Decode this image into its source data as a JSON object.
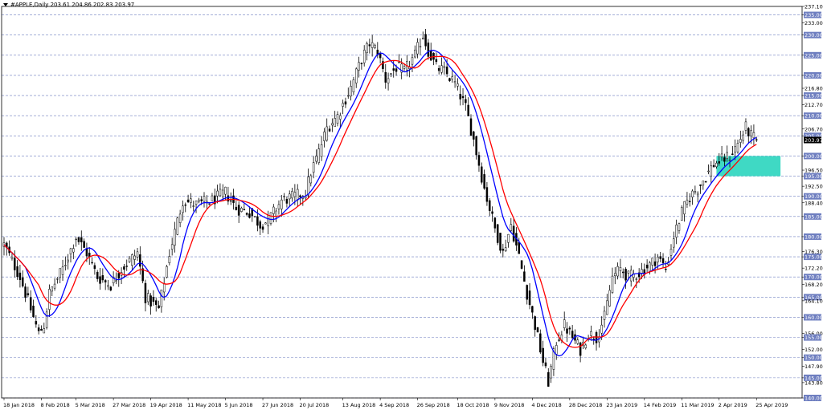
{
  "header": {
    "title": "#APPLE,Daily  203.61 204.86 202.83 203.97"
  },
  "chart_data": {
    "type": "candlestick",
    "title": "#APPLE,Daily  203.61 204.86 202.83 203.97",
    "ylim": [
      140.0,
      237.1
    ],
    "grid": true,
    "y_ticks": [
      {
        "value": 237.1,
        "label": "237.10",
        "badge": false
      },
      {
        "value": 235.0,
        "label": "235.00",
        "badge": true
      },
      {
        "value": 233.0,
        "label": "233.00",
        "badge": false
      },
      {
        "value": 230.0,
        "label": "230.00",
        "badge": true
      },
      {
        "value": 225.0,
        "label": "225.00",
        "badge": true
      },
      {
        "value": 220.0,
        "label": "220.00",
        "badge": true
      },
      {
        "value": 216.8,
        "label": "216.80",
        "badge": false
      },
      {
        "value": 215.0,
        "label": "215.00",
        "badge": true
      },
      {
        "value": 212.7,
        "label": "212.70",
        "badge": false
      },
      {
        "value": 210.0,
        "label": "210.00",
        "badge": true
      },
      {
        "value": 206.7,
        "label": "206.70",
        "badge": false
      },
      {
        "value": 205.0,
        "label": "205.00",
        "badge": true
      },
      {
        "value": 200.0,
        "label": "200.00",
        "badge": true
      },
      {
        "value": 196.5,
        "label": "196.50",
        "badge": false
      },
      {
        "value": 195.0,
        "label": "195.00",
        "badge": true
      },
      {
        "value": 192.5,
        "label": "192.50",
        "badge": false
      },
      {
        "value": 190.0,
        "label": "190.00",
        "badge": true
      },
      {
        "value": 188.4,
        "label": "188.40",
        "badge": false
      },
      {
        "value": 185.0,
        "label": "185.00",
        "badge": true
      },
      {
        "value": 180.0,
        "label": "180.00",
        "badge": true
      },
      {
        "value": 176.3,
        "label": "176.30",
        "badge": false
      },
      {
        "value": 175.0,
        "label": "175.00",
        "badge": true
      },
      {
        "value": 172.2,
        "label": "172.20",
        "badge": false
      },
      {
        "value": 170.0,
        "label": "170.00",
        "badge": true
      },
      {
        "value": 168.2,
        "label": "168.20",
        "badge": false
      },
      {
        "value": 165.0,
        "label": "165.00",
        "badge": true
      },
      {
        "value": 164.1,
        "label": "164.10",
        "badge": false
      },
      {
        "value": 160.0,
        "label": "160.00",
        "badge": true
      },
      {
        "value": 156.0,
        "label": "156.00",
        "badge": false
      },
      {
        "value": 155.0,
        "label": "155.00",
        "badge": true
      },
      {
        "value": 152.0,
        "label": "152.00",
        "badge": false
      },
      {
        "value": 150.0,
        "label": "150.00",
        "badge": true
      },
      {
        "value": 147.9,
        "label": "147.90",
        "badge": false
      },
      {
        "value": 145.0,
        "label": "145.00",
        "badge": true
      },
      {
        "value": 143.8,
        "label": "143.80",
        "badge": false
      },
      {
        "value": 140.0,
        "label": "140.00",
        "badge": true
      }
    ],
    "dashed_levels": [
      235,
      230,
      225,
      220,
      215,
      210,
      205,
      200,
      195,
      190,
      185,
      180,
      175,
      170,
      165,
      160,
      155,
      150,
      145,
      140
    ],
    "x_ticks": [
      {
        "bar": 0,
        "label": "18 Jan 2018"
      },
      {
        "bar": 14,
        "label": "8 Feb 2018"
      },
      {
        "bar": 27,
        "label": "5 Mar 2018"
      },
      {
        "bar": 41,
        "label": "27 Mar 2018"
      },
      {
        "bar": 55,
        "label": "19 Apr 2018"
      },
      {
        "bar": 69,
        "label": "11 May 2018"
      },
      {
        "bar": 83,
        "label": "5 Jun 2018"
      },
      {
        "bar": 97,
        "label": "27 Jun 2018"
      },
      {
        "bar": 111,
        "label": "20 Jul 2018"
      },
      {
        "bar": 127,
        "label": "13 Aug 2018"
      },
      {
        "bar": 141,
        "label": "4 Sep 2018"
      },
      {
        "bar": 155,
        "label": "26 Sep 2018"
      },
      {
        "bar": 170,
        "label": "18 Oct 2018"
      },
      {
        "bar": 184,
        "label": "9 Nov 2018"
      },
      {
        "bar": 198,
        "label": "4 Dec 2018"
      },
      {
        "bar": 212,
        "label": "28 Dec 2018"
      },
      {
        "bar": 226,
        "label": "23 Jan 2019"
      },
      {
        "bar": 240,
        "label": "14 Feb 2019"
      },
      {
        "bar": 254,
        "label": "11 Mar 2019"
      },
      {
        "bar": 268,
        "label": "2 Apr 2019"
      },
      {
        "bar": 282,
        "label": "25 Apr 2019"
      }
    ],
    "last_price": {
      "value": 203.97,
      "label": "203.97"
    },
    "close_path": [
      [
        0,
        178
      ],
      [
        6,
        170
      ],
      [
        10,
        162
      ],
      [
        13,
        156
      ],
      [
        15,
        158
      ],
      [
        17,
        166
      ],
      [
        22,
        172
      ],
      [
        27,
        180
      ],
      [
        31,
        176
      ],
      [
        35,
        170
      ],
      [
        40,
        168
      ],
      [
        44,
        172
      ],
      [
        50,
        176
      ],
      [
        53,
        165
      ],
      [
        58,
        162
      ],
      [
        62,
        176
      ],
      [
        67,
        189
      ],
      [
        72,
        188
      ],
      [
        78,
        189
      ],
      [
        83,
        191
      ],
      [
        87,
        187
      ],
      [
        92,
        186
      ],
      [
        96,
        183
      ],
      [
        99,
        184
      ],
      [
        104,
        189
      ],
      [
        109,
        190
      ],
      [
        113,
        191
      ],
      [
        115,
        196
      ],
      [
        118,
        201
      ],
      [
        121,
        207
      ],
      [
        125,
        210
      ],
      [
        130,
        217
      ],
      [
        134,
        224
      ],
      [
        137,
        228
      ],
      [
        140,
        226
      ],
      [
        143,
        219
      ],
      [
        147,
        222
      ],
      [
        150,
        221
      ],
      [
        154,
        225
      ],
      [
        157,
        230
      ],
      [
        159,
        226
      ],
      [
        162,
        222
      ],
      [
        165,
        221
      ],
      [
        169,
        218
      ],
      [
        173,
        212
      ],
      [
        176,
        204
      ],
      [
        180,
        192
      ],
      [
        184,
        182
      ],
      [
        187,
        176
      ],
      [
        190,
        183
      ],
      [
        193,
        175
      ],
      [
        196,
        166
      ],
      [
        199,
        158
      ],
      [
        202,
        149
      ],
      [
        204,
        144
      ],
      [
        207,
        154
      ],
      [
        210,
        158
      ],
      [
        213,
        155
      ],
      [
        216,
        152
      ],
      [
        219,
        156
      ],
      [
        222,
        155
      ],
      [
        225,
        160
      ],
      [
        228,
        170
      ],
      [
        231,
        172
      ],
      [
        234,
        170
      ],
      [
        238,
        171
      ],
      [
        242,
        173
      ],
      [
        245,
        175
      ],
      [
        248,
        172
      ],
      [
        251,
        180
      ],
      [
        254,
        186
      ],
      [
        257,
        190
      ],
      [
        260,
        192
      ],
      [
        263,
        195
      ],
      [
        266,
        198
      ],
      [
        269,
        199
      ],
      [
        272,
        200
      ],
      [
        275,
        203
      ],
      [
        278,
        207
      ],
      [
        280,
        205
      ],
      [
        282,
        204
      ]
    ],
    "series": [
      {
        "name": "",
        "color": "#0000ff",
        "period": 9
      },
      {
        "name": "",
        "color": "#ff0000",
        "period": 14
      }
    ],
    "zone": {
      "from_bar": 267,
      "to_bar": 291,
      "top": 200.0,
      "bottom": 195.0,
      "color": "#3fd9c4"
    }
  }
}
